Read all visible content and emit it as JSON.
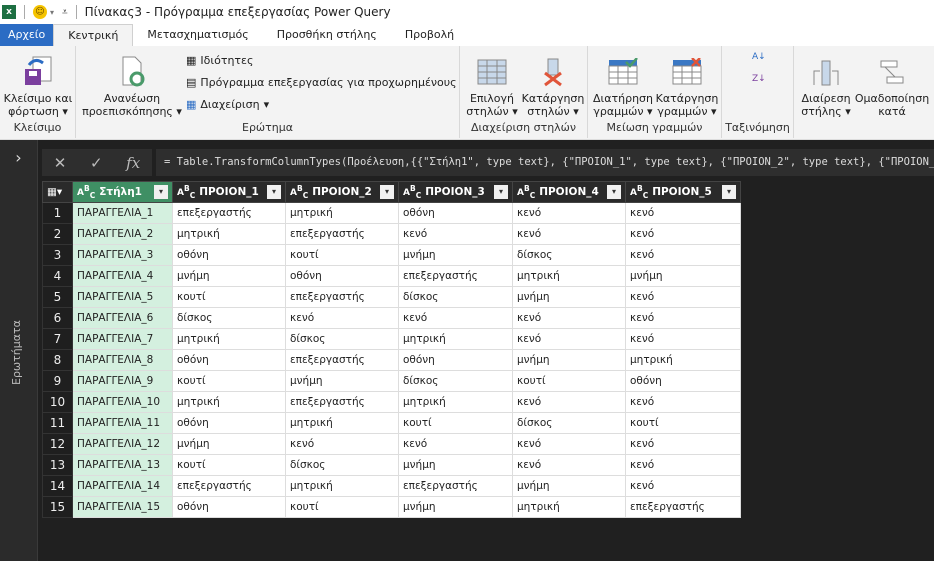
{
  "window": {
    "title": "Πίνακας3 - Πρόγραμμα επεξεργασίας Power Query"
  },
  "tabs": [
    "Αρχείο",
    "Κεντρική",
    "Μετασχηματισμός",
    "Προσθήκη στήλης",
    "Προβολή"
  ],
  "active_tab": "Κεντρική",
  "ribbon": {
    "close": {
      "button": "Κλείσιμο και φόρτωση",
      "group": "Κλείσιμο"
    },
    "query": {
      "refresh": "Ανανέωση προεπισκόπησης",
      "properties": "Ιδιότητες",
      "advanced_editor": "Πρόγραμμα επεξεργασίας για προχωρημένους",
      "manage": "Διαχείριση",
      "group": "Ερώτημα"
    },
    "columns": {
      "choose": "Επιλογή στηλών",
      "remove": "Κατάργηση στηλών",
      "group": "Διαχείριση στηλών"
    },
    "rows": {
      "keep": "Διατήρηση γραμμών",
      "remove": "Κατάργηση γραμμών",
      "group": "Μείωση γραμμών"
    },
    "sort": {
      "group": "Ταξινόμηση"
    },
    "transform": {
      "split": "Διαίρεση στήλης",
      "group_by": "Ομαδοποίηση κατά"
    }
  },
  "nav": {
    "queries_label": "Ερωτήματα"
  },
  "formula": "= Table.TransformColumnTypes(Προέλευση,{{\"Στήλη1\", type text}, {\"ΠΡΟΙΟΝ_1\", type text}, {\"ΠΡΟΙΟΝ_2\", type text}, {\"ΠΡΟΙΟΝ_3\", type text}, {\"ΠΡ",
  "table": {
    "headers": [
      "Στήλη1",
      "ΠΡΟΙΟΝ_1",
      "ΠΡΟΙΟΝ_2",
      "ΠΡΟΙΟΝ_3",
      "ΠΡΟΙΟΝ_4",
      "ΠΡΟΙΟΝ_5"
    ],
    "type_icon": "ABC",
    "rows": [
      [
        "ΠΑΡΑΓΓΕΛΙΑ_1",
        "επεξεργαστής",
        "μητρική",
        "οθόνη",
        "κενό",
        "κενό"
      ],
      [
        "ΠΑΡΑΓΓΕΛΙΑ_2",
        "μητρική",
        "επεξεργαστής",
        "κενό",
        "κενό",
        "κενό"
      ],
      [
        "ΠΑΡΑΓΓΕΛΙΑ_3",
        "οθόνη",
        "κουτί",
        "μνήμη",
        "δίσκος",
        "κενό"
      ],
      [
        "ΠΑΡΑΓΓΕΛΙΑ_4",
        "μνήμη",
        "οθόνη",
        "επεξεργαστής",
        "μητρική",
        "μνήμη"
      ],
      [
        "ΠΑΡΑΓΓΕΛΙΑ_5",
        "κουτί",
        "επεξεργαστής",
        "δίσκος",
        "μνήμη",
        "κενό"
      ],
      [
        "ΠΑΡΑΓΓΕΛΙΑ_6",
        "δίσκος",
        "κενό",
        "κενό",
        "κενό",
        "κενό"
      ],
      [
        "ΠΑΡΑΓΓΕΛΙΑ_7",
        "μητρική",
        "δίσκος",
        "μητρική",
        "κενό",
        "κενό"
      ],
      [
        "ΠΑΡΑΓΓΕΛΙΑ_8",
        "οθόνη",
        "επεξεργαστής",
        "οθόνη",
        "μνήμη",
        "μητρική"
      ],
      [
        "ΠΑΡΑΓΓΕΛΙΑ_9",
        "κουτί",
        "μνήμη",
        "δίσκος",
        "κουτί",
        "οθόνη"
      ],
      [
        "ΠΑΡΑΓΓΕΛΙΑ_10",
        "μητρική",
        "επεξεργαστής",
        "μητρική",
        "κενό",
        "κενό"
      ],
      [
        "ΠΑΡΑΓΓΕΛΙΑ_11",
        "οθόνη",
        "μητρική",
        "κουτί",
        "δίσκος",
        "κουτί"
      ],
      [
        "ΠΑΡΑΓΓΕΛΙΑ_12",
        "μνήμη",
        "κενό",
        "κενό",
        "κενό",
        "κενό"
      ],
      [
        "ΠΑΡΑΓΓΕΛΙΑ_13",
        "κουτί",
        "δίσκος",
        "μνήμη",
        "κενό",
        "κενό"
      ],
      [
        "ΠΑΡΑΓΓΕΛΙΑ_14",
        "επεξεργαστής",
        "μητρική",
        "επεξεργαστής",
        "μνήμη",
        "κενό"
      ],
      [
        "ΠΑΡΑΓΓΕΛΙΑ_15",
        "οθόνη",
        "κουτί",
        "μνήμη",
        "μητρική",
        "επεξεργαστής"
      ]
    ]
  },
  "colors": {
    "file_tab": "#2b6cc4",
    "selected_column": "#3f8f64",
    "selected_cells": "#d4f0df"
  }
}
